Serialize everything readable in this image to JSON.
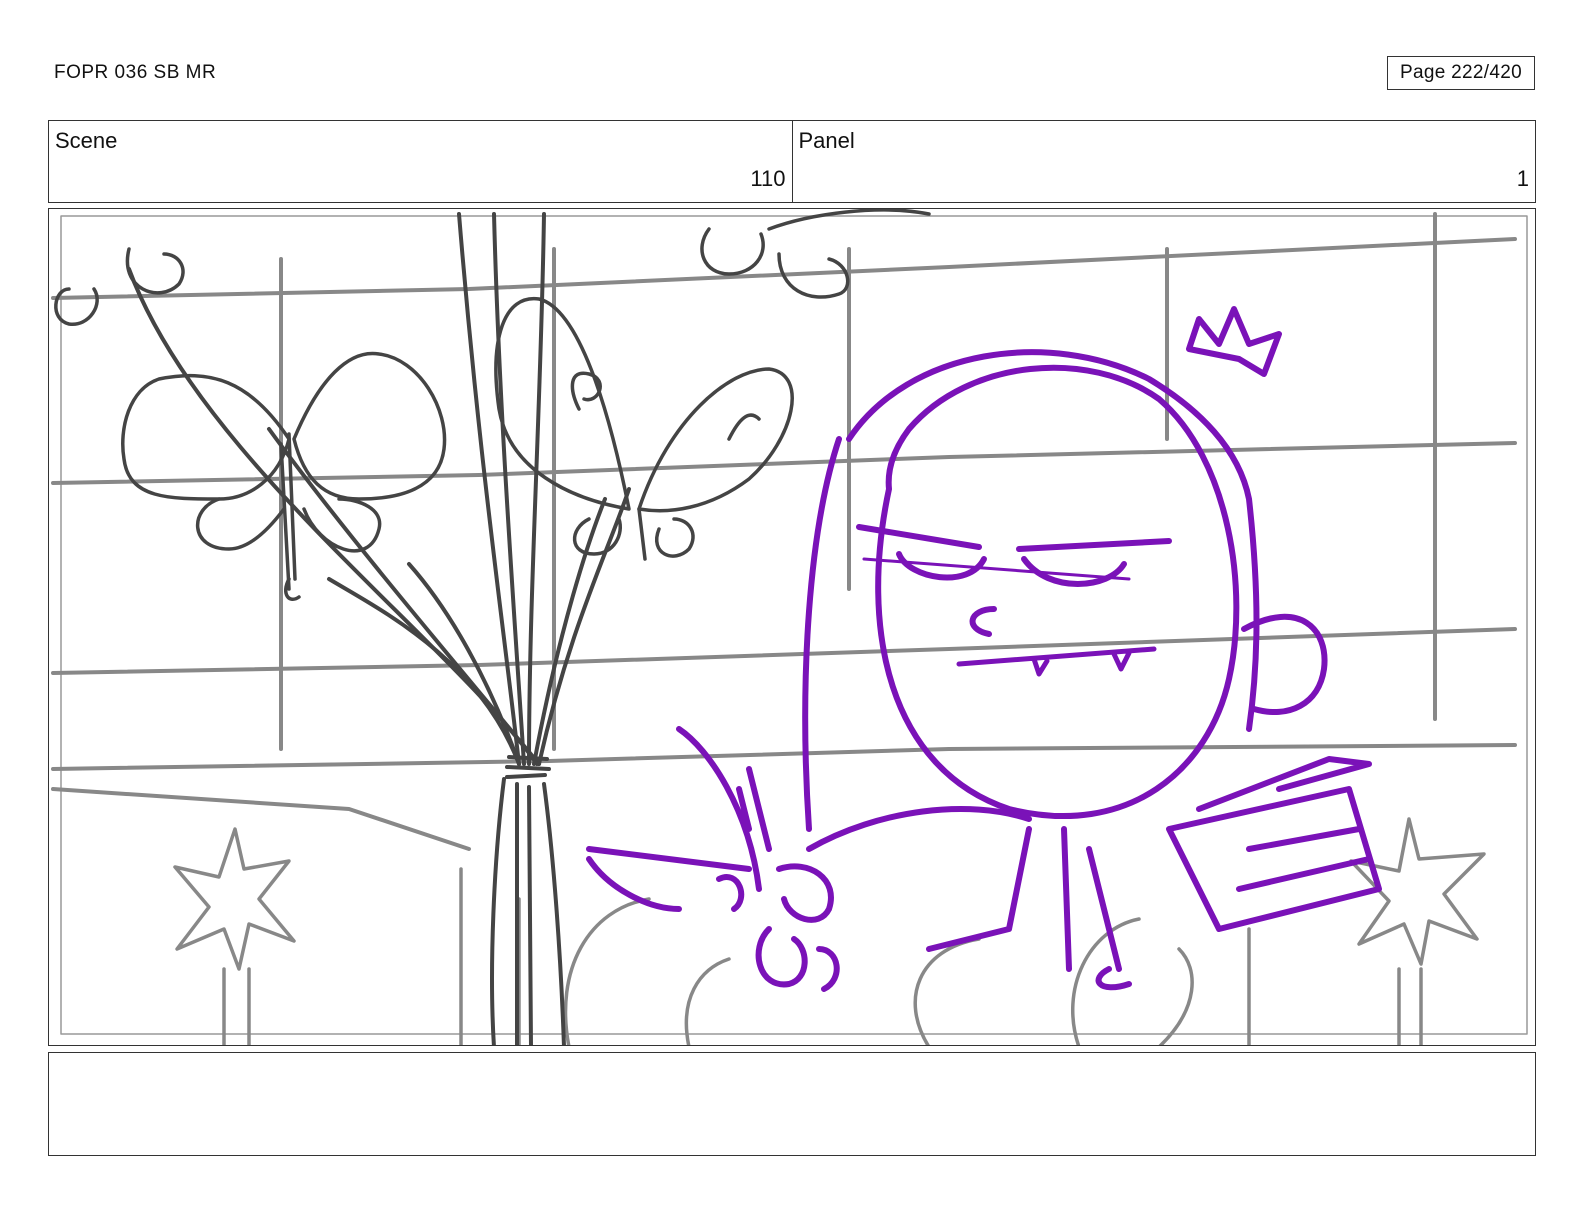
{
  "header": {
    "doc_title": "FOPR 036 SB MR",
    "page_indicator": "Page 222/420"
  },
  "info": {
    "scene_label": "Scene",
    "scene_value": "110",
    "panel_label": "Panel",
    "panel_value": "1"
  },
  "drawing": {
    "background_color": "#888888",
    "midground_color": "#444444",
    "character_color": "#7a12b8"
  },
  "notes": {
    "text": ""
  }
}
